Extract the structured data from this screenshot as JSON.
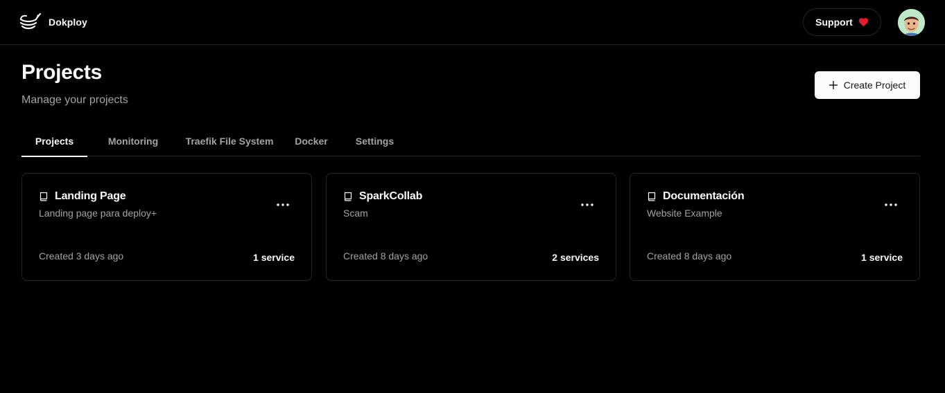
{
  "app": {
    "brand_name": "Dokploy",
    "logo_icon": "dokploy-logo-icon",
    "support_label": "Support",
    "support_icon": "heart-icon",
    "avatar_icon": "memoji-avatar"
  },
  "header": {
    "title": "Projects",
    "subtitle": "Manage your projects",
    "create_label": "Create Project",
    "create_icon": "plus-icon"
  },
  "tabs": [
    {
      "label": "Projects",
      "active": true
    },
    {
      "label": "Monitoring",
      "active": false
    },
    {
      "label": "Traefik File System",
      "active": false
    },
    {
      "label": "Docker",
      "active": false
    },
    {
      "label": "Settings",
      "active": false
    }
  ],
  "projects": [
    {
      "name": "Landing Page",
      "description": "Landing page para deploy+",
      "created": "Created 3 days ago",
      "services": "1 service",
      "icon": "book-icon"
    },
    {
      "name": "SparkCollab",
      "description": "Scam",
      "created": "Created 8 days ago",
      "services": "2 services",
      "icon": "book-icon"
    },
    {
      "name": "Documentación",
      "description": "Website Example",
      "created": "Created 8 days ago",
      "services": "1 service",
      "icon": "book-icon"
    }
  ],
  "colors": {
    "background": "#000000",
    "border": "#262626",
    "text": "#fafafa",
    "muted": "#a3a3a3",
    "heart": "#e11d2e",
    "button_bg": "#fafafa"
  }
}
